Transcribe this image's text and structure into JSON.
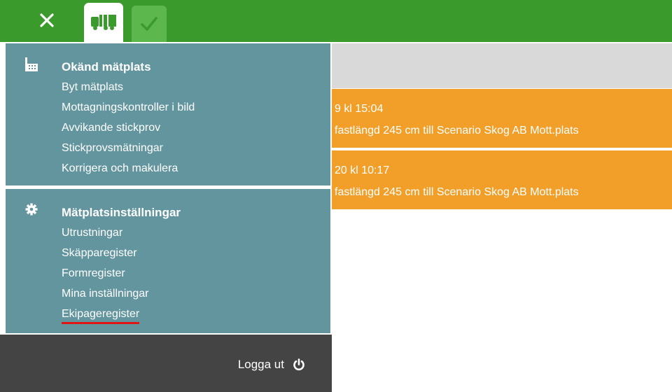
{
  "topbar": {
    "close_icon": "close-icon",
    "truck_icon": "truck-icon",
    "check_icon": "check-icon",
    "color": "#3a9b2c"
  },
  "background_rows": [
    {
      "line1": "9 kl 15:04",
      "line2": "fastlängd 245 cm till Scenario Skog AB Mott.plats"
    },
    {
      "line1": "20 kl 10:17",
      "line2": "fastlängd 245 cm till Scenario Skog AB Mott.plats"
    }
  ],
  "menu": {
    "section1": {
      "icon": "building-icon",
      "title": "Okänd mätplats",
      "items": [
        "Byt mätplats",
        "Mottagningskontroller i bild",
        "Avvikande stickprov",
        "Stickprovsmätningar",
        "Korrigera och makulera"
      ]
    },
    "section2": {
      "icon": "gear-icon",
      "title": "Mätplatsinställningar",
      "items": [
        "Utrustningar",
        "Skäpparegister",
        "Formregister",
        "Mina inställningar",
        "Ekipageregister"
      ]
    },
    "logout_label": "Logga ut",
    "logout_icon": "power-icon",
    "panel_color": "#63959f"
  }
}
